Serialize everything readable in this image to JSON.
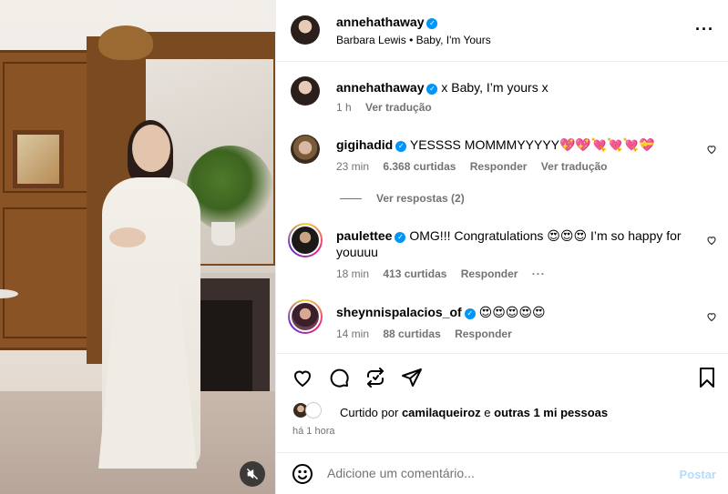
{
  "post": {
    "author": "annehathaway",
    "audio": "Barbara Lewis",
    "separator": "•",
    "song": "Baby, I'm Yours",
    "caption": "x Baby, I’m yours x",
    "caption_time": "1 h",
    "caption_translate": "Ver tradução"
  },
  "comments": [
    {
      "user": "gigihadid",
      "text": "YESSSS MOMMMYYYYY💖💖💘💘💘💝",
      "time": "23 min",
      "likes": "6.368 curtidas",
      "reply": "Responder",
      "translate": "Ver tradução",
      "view_replies": "Ver respostas (2)"
    },
    {
      "user": "paulettee",
      "text": "OMG!!! Congratulations 😍😍😍 I’m so happy for youuuu",
      "time": "18 min",
      "likes": "413 curtidas",
      "reply": "Responder"
    },
    {
      "user": "sheynnispalacios_of",
      "text": "😍😍😍😍😍",
      "time": "14 min",
      "likes": "88 curtidas",
      "reply": "Responder"
    }
  ],
  "engagement": {
    "liked_by_prefix": "Curtido por",
    "liked_by_user": "camilaqueiroz",
    "liked_by_and": "e",
    "liked_by_rest": "outras 1 mi pessoas",
    "time_ago": "há 1 hora"
  },
  "comment_box": {
    "placeholder": "Adicione um comentário...",
    "post_label": "Postar"
  },
  "icons": {
    "more": "more-options-icon",
    "like": "heart-icon",
    "comment": "comment-icon",
    "share": "repost-icon",
    "send": "send-icon",
    "save": "bookmark-icon",
    "emoji": "emoji-icon",
    "mute": "mute-icon"
  },
  "colors": {
    "verified": "#0095f6",
    "muted_text": "#737373",
    "post_button": "#b3dbff"
  }
}
